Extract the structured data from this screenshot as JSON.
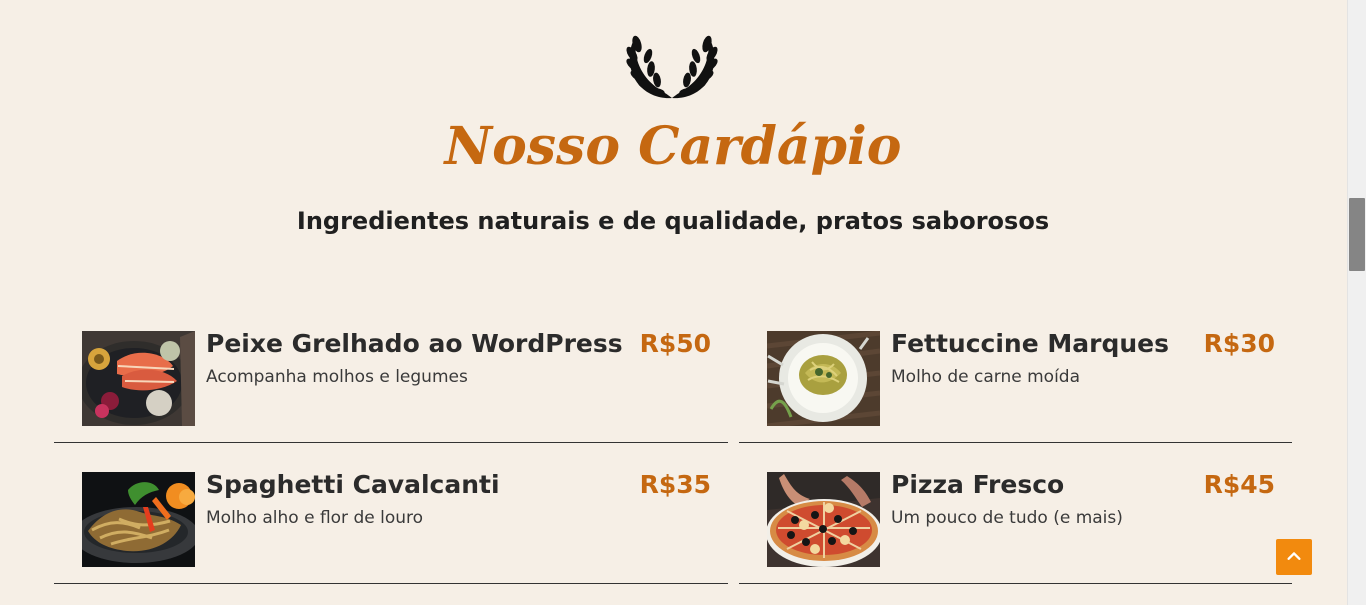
{
  "header": {
    "title": "Nosso Cardápio",
    "subtitle": "Ingredientes naturais e de qualidade, pratos saborosos",
    "icon": "laurel-wreath-icon"
  },
  "menu": {
    "items": [
      {
        "name": "Peixe Grelhado ao WordPress",
        "description": "Acompanha molhos e legumes",
        "price": "R$50",
        "image": "grilled-fish-image"
      },
      {
        "name": "Fettuccine Marques",
        "description": "Molho de carne moída",
        "price": "R$30",
        "image": "fettuccine-image"
      },
      {
        "name": "Spaghetti Cavalcanti",
        "description": "Molho alho e flor de louro",
        "price": "R$35",
        "image": "spaghetti-image"
      },
      {
        "name": "Pizza Fresco",
        "description": "Um pouco de tudo (e mais)",
        "price": "R$45",
        "image": "pizza-image"
      }
    ]
  },
  "colors": {
    "background": "#f6efe6",
    "accent": "#c56811",
    "button": "#f28a0e",
    "text": "#2b2b2b"
  },
  "controls": {
    "back_to_top_icon": "chevron-up-icon"
  }
}
